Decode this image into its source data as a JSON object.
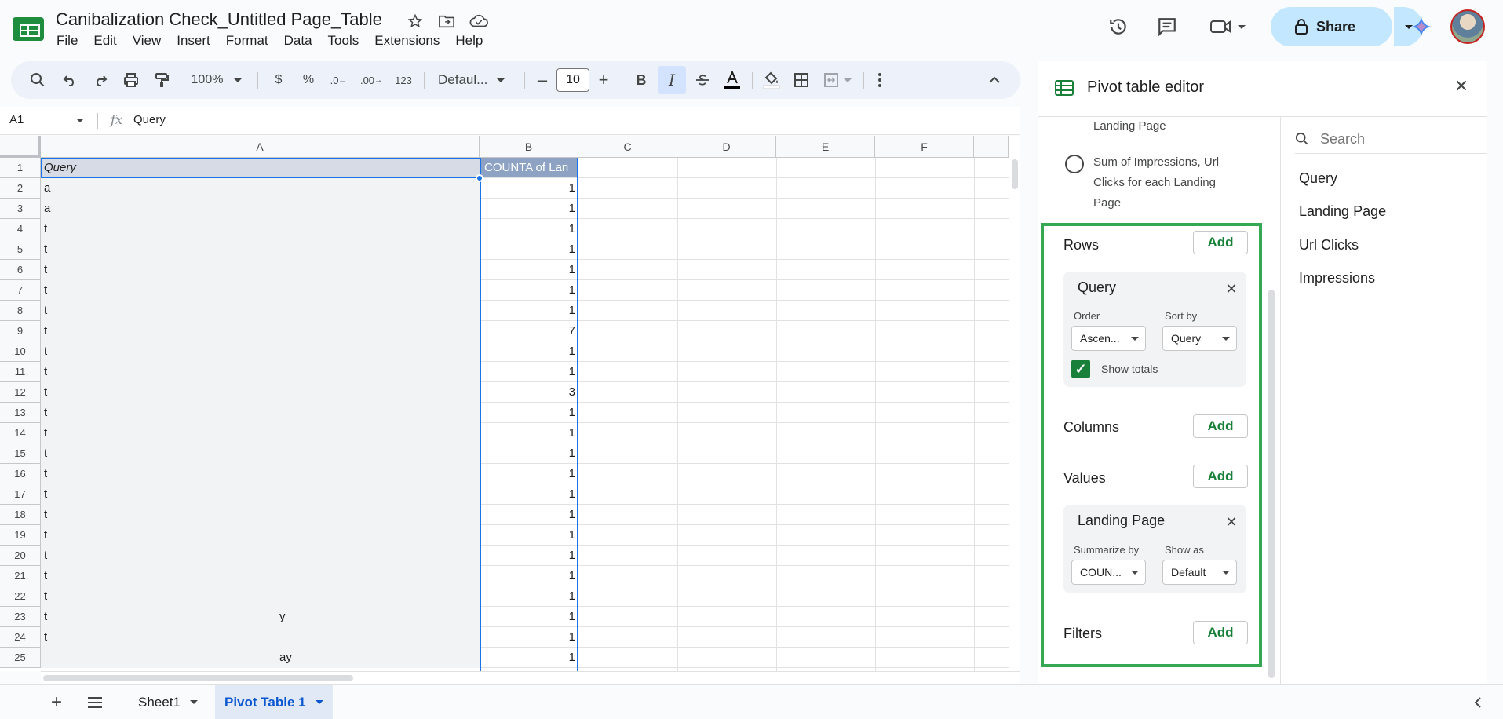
{
  "app": {
    "doc_title": "Canibalization Check_Untitled Page_Table",
    "menu": [
      "File",
      "Edit",
      "View",
      "Insert",
      "Format",
      "Data",
      "Tools",
      "Extensions",
      "Help"
    ],
    "share_label": "Share"
  },
  "toolbar": {
    "zoom": "100%",
    "currency": "$",
    "percent": "%",
    "dec_decrease": ".0",
    "dec_increase": ".00",
    "number_format": "123",
    "font": "Defaul...",
    "font_size": "10",
    "bold": "B",
    "italic": "I",
    "minus": "–",
    "plus": "+"
  },
  "formula_bar": {
    "name_box": "A1",
    "fx": "fx",
    "value": "Query"
  },
  "grid": {
    "columns": [
      "A",
      "B",
      "C",
      "D",
      "E",
      "F"
    ],
    "header_row": {
      "a": "Query",
      "b": "COUNTA of Lan"
    },
    "rows": [
      {
        "n": "1",
        "a": "",
        "b": ""
      },
      {
        "n": "2",
        "a": "a",
        "b": "1"
      },
      {
        "n": "3",
        "a": "a",
        "b": "1"
      },
      {
        "n": "4",
        "a": "t",
        "b": "1"
      },
      {
        "n": "5",
        "a": "t",
        "b": "1"
      },
      {
        "n": "6",
        "a": "t",
        "b": "1"
      },
      {
        "n": "7",
        "a": "t",
        "b": "1"
      },
      {
        "n": "8",
        "a": "t",
        "b": "1"
      },
      {
        "n": "9",
        "a": "t",
        "b": "7"
      },
      {
        "n": "10",
        "a": "t",
        "b": "1"
      },
      {
        "n": "11",
        "a": "t",
        "b": "1"
      },
      {
        "n": "12",
        "a": "t",
        "b": "3"
      },
      {
        "n": "13",
        "a": "t",
        "b": "1"
      },
      {
        "n": "14",
        "a": "t",
        "b": "1"
      },
      {
        "n": "15",
        "a": "t",
        "b": "1"
      },
      {
        "n": "16",
        "a": "t",
        "b": "1"
      },
      {
        "n": "17",
        "a": "t",
        "b": "1"
      },
      {
        "n": "18",
        "a": "t",
        "b": "1"
      },
      {
        "n": "19",
        "a": "t",
        "b": "1"
      },
      {
        "n": "20",
        "a": "t",
        "b": "1"
      },
      {
        "n": "21",
        "a": "t",
        "b": "1"
      },
      {
        "n": "22",
        "a": "t",
        "b": "1"
      },
      {
        "n": "23",
        "a": "t",
        "a2": "y",
        "b": "1"
      },
      {
        "n": "24",
        "a": "t",
        "b": "1"
      },
      {
        "n": "25",
        "a": "",
        "a2": "ay",
        "b": "1"
      }
    ]
  },
  "sheets": {
    "tabs": [
      "Sheet1",
      "Pivot Table 1"
    ],
    "active": "Pivot Table 1"
  },
  "panel": {
    "title": "Pivot table editor",
    "suggest_1_tail": "Landing Page",
    "suggest_2": "Sum of Impressions, Url Clicks for each Landing Page",
    "rows_label": "Rows",
    "columns_label": "Columns",
    "values_label": "Values",
    "filters_label": "Filters",
    "add_label": "Add",
    "rows_card": {
      "title": "Query",
      "order_label": "Order",
      "order_value": "Ascen...",
      "sortby_label": "Sort by",
      "sortby_value": "Query",
      "show_totals": "Show totals"
    },
    "values_card": {
      "title": "Landing Page",
      "summarize_label": "Summarize by",
      "summarize_value": "COUN...",
      "showas_label": "Show as",
      "showas_value": "Default"
    },
    "search_placeholder": "Search",
    "fields": [
      "Query",
      "Landing Page",
      "Url Clicks",
      "Impressions"
    ]
  },
  "colors": {
    "accent": "#1a73e8",
    "highlight_border": "#34a853",
    "add_text": "#188038",
    "share_bg": "#c2e7ff"
  }
}
